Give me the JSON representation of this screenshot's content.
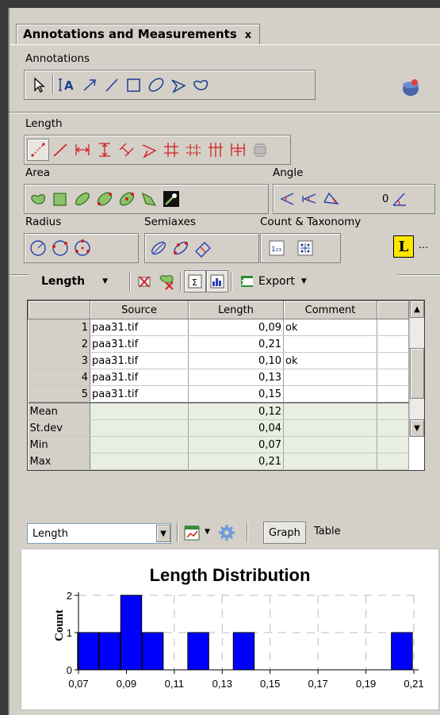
{
  "panel": {
    "tab_title": "Annotations and Measurements",
    "tab_close": "x",
    "annotations_label": "Annotations",
    "length_label": "Length",
    "area_label": "Area",
    "angle_label": "Angle",
    "angle_value": "0",
    "radius_label": "Radius",
    "semiaxes_label": "Semiaxes",
    "count_label": "Count & Taxonomy",
    "ellipsis": "..."
  },
  "results_toolbar": {
    "measurement_select": "Length",
    "export_label": "Export"
  },
  "table": {
    "columns": [
      "",
      "Source",
      "Length",
      "Comment",
      ""
    ],
    "rows": [
      {
        "n": "1",
        "source": "paa31.tif",
        "length": "0,09",
        "comment": "ok"
      },
      {
        "n": "2",
        "source": "paa31.tif",
        "length": "0,21",
        "comment": ""
      },
      {
        "n": "3",
        "source": "paa31.tif",
        "length": "0,10",
        "comment": "ok"
      },
      {
        "n": "4",
        "source": "paa31.tif",
        "length": "0,13",
        "comment": ""
      },
      {
        "n": "5",
        "source": "paa31.tif",
        "length": "0,15",
        "comment": ""
      }
    ],
    "stats": [
      {
        "name": "Mean",
        "value": "0,12"
      },
      {
        "name": "St.dev",
        "value": "0,04"
      },
      {
        "name": "Min",
        "value": "0,07"
      },
      {
        "name": "Max",
        "value": "0,21"
      }
    ]
  },
  "graph_toolbar": {
    "graph_select": "Length",
    "graph_tab": "Graph",
    "table_tab": "Table"
  },
  "chart_data": {
    "type": "bar",
    "title": "Length Distribution",
    "xlabel": "",
    "ylabel": "Count",
    "bar_color": "#0000ff",
    "xlim": [
      0.07,
      0.21
    ],
    "ylim": [
      0,
      2
    ],
    "xticks": [
      "0,07",
      "0,09",
      "0,11",
      "0,13",
      "0,15",
      "0,17",
      "0,19",
      "0,21"
    ],
    "yticks": [
      "0",
      "1",
      "2"
    ],
    "bins": [
      {
        "x": 0.074,
        "count": 1
      },
      {
        "x": 0.083,
        "count": 1
      },
      {
        "x": 0.092,
        "count": 2
      },
      {
        "x": 0.101,
        "count": 1
      },
      {
        "x": 0.12,
        "count": 1
      },
      {
        "x": 0.139,
        "count": 1
      },
      {
        "x": 0.205,
        "count": 1
      }
    ],
    "grid": true
  }
}
